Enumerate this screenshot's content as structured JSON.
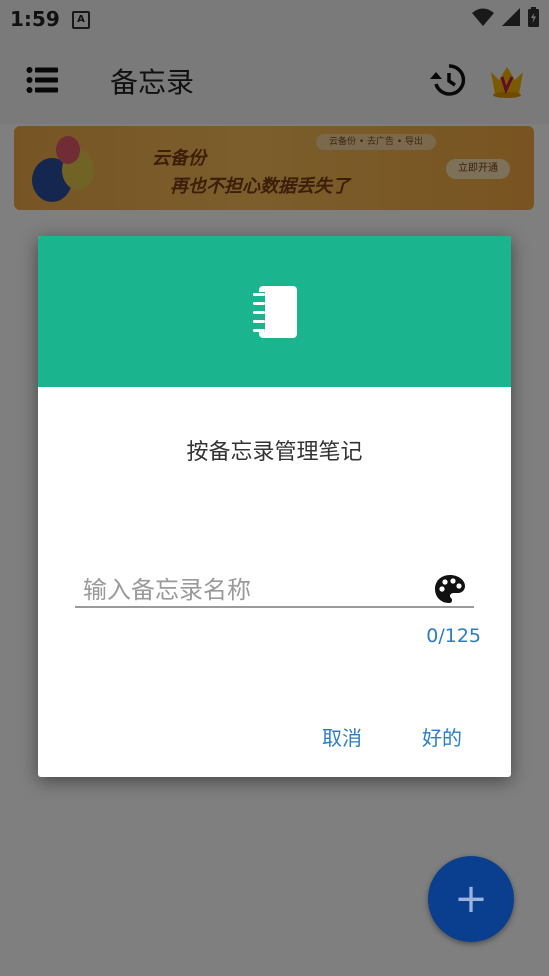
{
  "status_bar": {
    "time": "1:59",
    "notification_badge": "A"
  },
  "app_bar": {
    "title": "备忘录"
  },
  "banner": {
    "tags": "云备份 • 去广告 • 导出",
    "line1": "云备份",
    "line2": "再也不担心数据丢失了",
    "button": "立即开通"
  },
  "dialog": {
    "title": "按备忘录管理笔记",
    "input_placeholder": "输入备忘录名称",
    "input_value": "",
    "counter": "0/125",
    "cancel_label": "取消",
    "ok_label": "好的"
  },
  "fab": {
    "label": "+"
  },
  "colors": {
    "dialog_header": "#1ab48e",
    "accent_text": "#2b7cc9",
    "fab_bg": "#0a3f8f"
  }
}
